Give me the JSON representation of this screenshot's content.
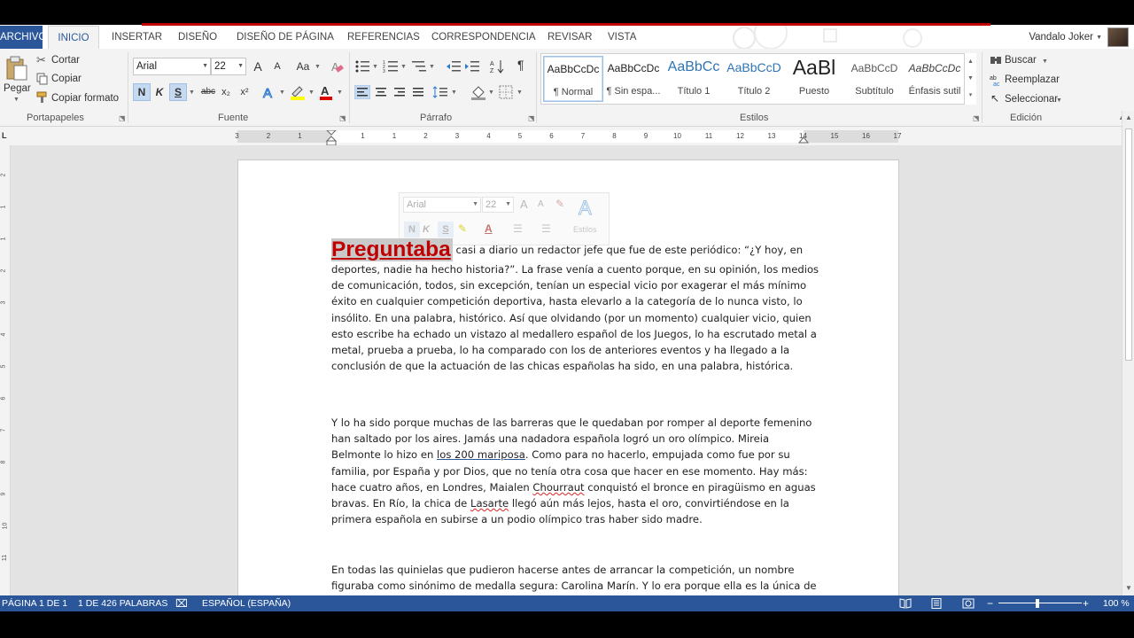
{
  "tabs": {
    "file": "ARCHIVO",
    "items": [
      "INICIO",
      "INSERTAR",
      "DISEÑO",
      "DISEÑO DE PÁGINA",
      "REFERENCIAS",
      "CORRESPONDENCIA",
      "REVISAR",
      "VISTA"
    ],
    "active": "INICIO",
    "user": "Vandalo Joker"
  },
  "ribbon": {
    "clipboard": {
      "paste": "Pegar",
      "cut": "Cortar",
      "copy": "Copiar",
      "format_painter": "Copiar formato",
      "label": "Portapapeles"
    },
    "font": {
      "family": "Arial",
      "size": "22",
      "label": "Fuente",
      "grow": "A",
      "shrink": "A",
      "case": "Aa",
      "bold": "N",
      "italic": "K",
      "underline": "S",
      "strike": "abc",
      "subscript": "x₂",
      "superscript": "x²"
    },
    "paragraph": {
      "label": "Párrafo"
    },
    "styles": {
      "label": "Estilos",
      "items": [
        {
          "sample": "AaBbCcDc",
          "name": "¶ Normal"
        },
        {
          "sample": "AaBbCcDc",
          "name": "¶ Sin espa..."
        },
        {
          "sample": "AaBbCc",
          "name": "Título 1"
        },
        {
          "sample": "AaBbCcD",
          "name": "Título 2"
        },
        {
          "sample": "AaBl",
          "name": "Puesto"
        },
        {
          "sample": "AaBbCcD",
          "name": "Subtítulo"
        },
        {
          "sample": "AaBbCcDc",
          "name": "Énfasis sutil"
        }
      ]
    },
    "editing": {
      "label": "Edición",
      "find": "Buscar",
      "replace": "Reemplazar",
      "select": "Seleccionar"
    }
  },
  "ruler": {
    "numbers": [
      "3",
      "2",
      "1",
      "1",
      "1",
      "2",
      "3",
      "4",
      "5",
      "6",
      "7",
      "8",
      "9",
      "10",
      "11",
      "12",
      "13",
      "14",
      "15",
      "16",
      "17"
    ],
    "vertical": [
      "2",
      "1",
      "1",
      "2",
      "3",
      "4",
      "5",
      "6",
      "7",
      "8",
      "9",
      "10",
      "11"
    ]
  },
  "mini_toolbar": {
    "font": "Arial",
    "size": "22",
    "styles": "Estilos",
    "bold": "N",
    "italic": "K",
    "underline": "S"
  },
  "document": {
    "first_word": "Preguntaba",
    "p1": [
      "casi a diario un redactor jefe que fue de este periódico: “¿Y hoy, en",
      "deportes, nadie ha hecho historia?”. La frase venía a cuento porque, en su opinión, los medios",
      "de comunicación, todos, sin excepción, tenían un especial vicio por exagerar el más mínimo",
      "éxito en cualquier competición deportiva, hasta elevarlo a la categoría de lo nunca visto, lo",
      "insólito. En una palabra, histórico. Así que olvidando (por un momento) cualquier vicio, quien",
      "esto escribe ha echado un vistazo al medallero español de los Juegos, lo ha escrutado metal a",
      "metal, prueba a prueba, lo ha comparado con los de anteriores eventos y ha llegado a la",
      "conclusión de que la actuación de las chicas españolas ha sido, en una palabra, histórica."
    ],
    "p2": [
      "Y lo ha sido porque muchas de las barreras que le quedaban por romper al deporte femenino",
      "han saltado por los aires. Jamás una nadadora española logró un oro olímpico. Mireia",
      {
        "pre": "Belmonte lo hizo en ",
        "mark": "los 200 mariposa",
        "post": ". Como para no hacerlo, empujada como fue por su"
      },
      "familia, por España y por Dios, que no tenía otra cosa que hacer en ese momento. Hay más:",
      {
        "pre": "hace cuatro años, en Londres, Maialen ",
        "mark": "Chourraut",
        "post": " conquistó el bronce en piragüismo en aguas"
      },
      {
        "pre": "bravas. En Río, la chica de ",
        "mark": "Lasarte",
        "post": " llegó aún más lejos, hasta el oro, convirtiéndose en la"
      },
      "primera española en subirse a un podio olímpico tras haber sido madre."
    ],
    "p3": [
      "En todas las quinielas que pudieron hacerse antes de arrancar la competición, un nombre",
      "figuraba como sinónimo de medalla segura: Carolina Marín. Y lo era porque ella es la única de"
    ]
  },
  "status": {
    "page": "PÁGINA 1 DE 1",
    "words": "1 DE 426 PALABRAS",
    "language": "ESPAÑOL (ESPAÑA)",
    "zoom": "100 %",
    "zoom_minus": "−",
    "zoom_plus": "+"
  },
  "colors": {
    "accent": "#2b579a",
    "heading_red": "#c00000"
  }
}
